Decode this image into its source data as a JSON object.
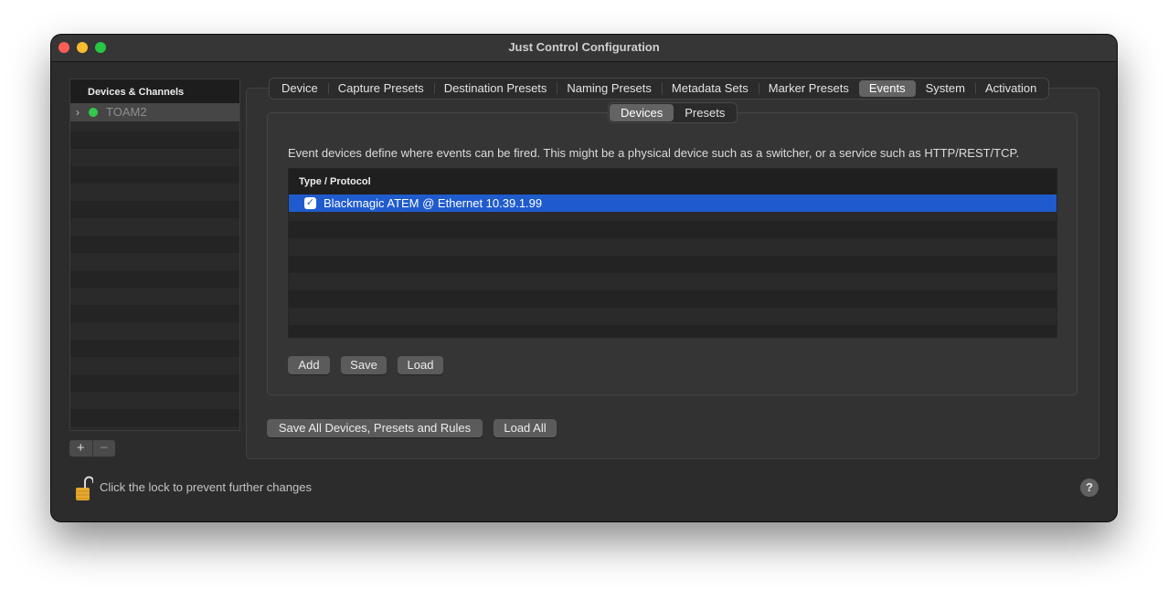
{
  "window": {
    "title": "Just Control Configuration"
  },
  "sidebar": {
    "header": "Devices & Channels",
    "items": [
      {
        "label": "TOAM2",
        "status_color": "#34c94a",
        "expand_icon": "chevron-right-icon"
      }
    ],
    "add_symbol": "+",
    "remove_symbol": "−"
  },
  "tabs": [
    {
      "label": "Device",
      "active": false
    },
    {
      "label": "Capture Presets",
      "active": false
    },
    {
      "label": "Destination Presets",
      "active": false
    },
    {
      "label": "Naming Presets",
      "active": false
    },
    {
      "label": "Metadata Sets",
      "active": false
    },
    {
      "label": "Marker Presets",
      "active": false
    },
    {
      "label": "Events",
      "active": true
    },
    {
      "label": "System",
      "active": false
    },
    {
      "label": "Activation",
      "active": false
    }
  ],
  "subtabs": [
    {
      "label": "Devices",
      "active": true
    },
    {
      "label": "Presets",
      "active": false
    }
  ],
  "events": {
    "description": "Event devices define where events can be fired. This might be a physical device such as a switcher, or a service such as HTTP/REST/TCP.",
    "table": {
      "column": "Type / Protocol",
      "rows": [
        {
          "checked": true,
          "label": "Blackmagic ATEM @ Ethernet 10.39.1.99"
        }
      ]
    },
    "buttons": {
      "add": "Add",
      "save": "Save",
      "load": "Load"
    }
  },
  "footer": {
    "save_all": "Save All Devices, Presets and Rules",
    "load_all": "Load All",
    "lock_text": "Click the lock to prevent further changes",
    "help": "?"
  },
  "colors": {
    "selection": "#1f5bcd",
    "status_online": "#34c94a",
    "lock": "#e7a92e"
  }
}
